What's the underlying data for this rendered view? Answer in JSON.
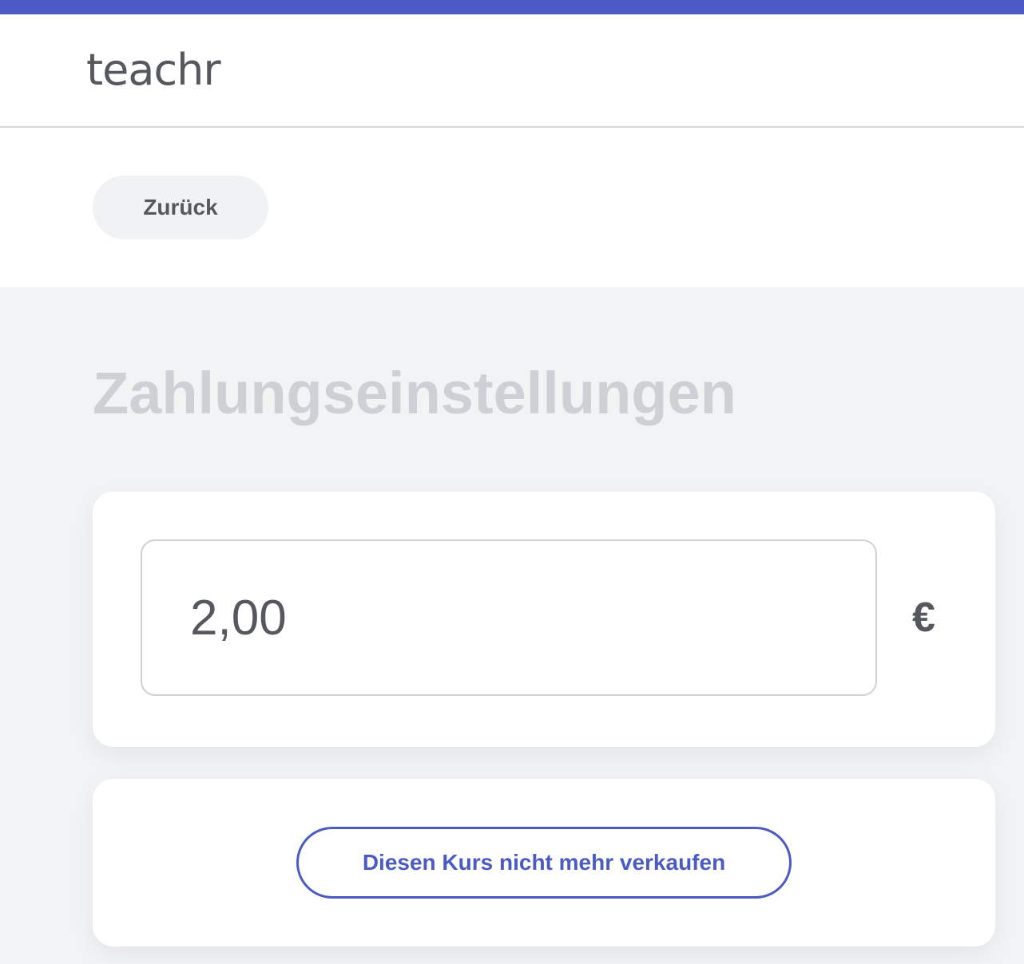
{
  "app": {
    "logo_text": "teachr"
  },
  "navigation": {
    "back_label": "Zurück"
  },
  "page": {
    "title": "Zahlungseinstellungen"
  },
  "price": {
    "value": "2,00",
    "currency_symbol": "€"
  },
  "actions": {
    "stop_selling_label": "Diesen Kurs nicht mehr verkaufen"
  },
  "colors": {
    "accent": "#4a5bc4",
    "text": "#55585d",
    "title_muted": "#cfd0d6",
    "background": "#f2f3f5",
    "card": "#ffffff"
  }
}
